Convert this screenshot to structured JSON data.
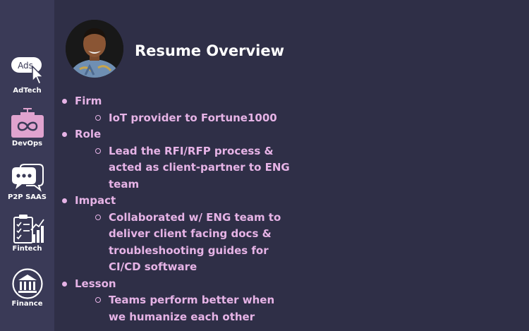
{
  "sidebar": {
    "items": [
      {
        "label": "AdTech",
        "icon": "ads-cursor-icon",
        "badge": "Ads"
      },
      {
        "label": "DevOps",
        "icon": "devops-infinity-icon"
      },
      {
        "label": "P2P SAAS",
        "icon": "chat-bubbles-icon"
      },
      {
        "label": "Fintech",
        "icon": "checklist-chart-icon"
      },
      {
        "label": "Finance",
        "icon": "bank-icon"
      }
    ]
  },
  "header": {
    "title": "Resume Overview"
  },
  "sections": [
    {
      "heading": "Firm",
      "detail": "IoT provider to Fortune1000"
    },
    {
      "heading": "Role",
      "detail": "Lead the RFI/RFP process & acted as client-partner to ENG team"
    },
    {
      "heading": "Impact",
      "detail": "Collaborated w/ ENG team to deliver client facing docs & troubleshooting guides for CI/CD software"
    },
    {
      "heading": "Lesson",
      "detail": "Teams perform better when we humanize each other"
    }
  ],
  "colors": {
    "background": "#2f2f47",
    "sidebar": "#3a3a57",
    "accent_text": "#e6b3e6",
    "icon_pink": "#e0a3cf",
    "title": "#ffffff"
  }
}
